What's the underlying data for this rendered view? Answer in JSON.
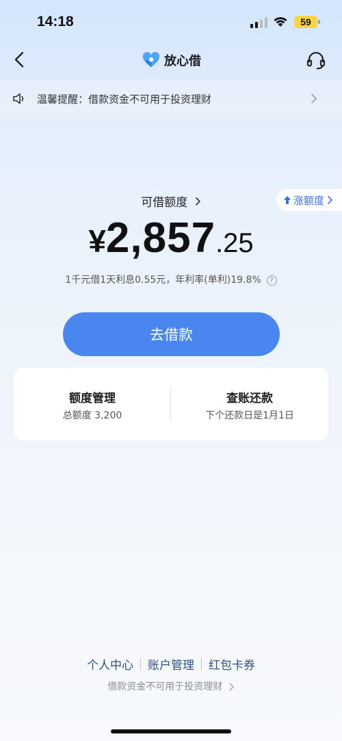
{
  "status_bar": {
    "time": "14:18",
    "battery": "59"
  },
  "nav": {
    "title": "放心借"
  },
  "notice": {
    "text": "温馨提醒：借款资金不可用于投资理财"
  },
  "raise": {
    "label": "涨额度"
  },
  "limit": {
    "title": "可借额度",
    "currency": "¥",
    "amount_int": "2,857",
    "amount_dec": ".25",
    "rate_text": "1千元借1天利息0.55元，年利率(单利)19.8%"
  },
  "borrow_button": {
    "label": "去借款"
  },
  "cards": {
    "quota": {
      "title": "额度管理",
      "sub": "总额度 3,200"
    },
    "bill": {
      "title": "查账还款",
      "sub": "下个还款日是1月1日"
    }
  },
  "footer": {
    "links": [
      "个人中心",
      "账户管理",
      "红包卡券"
    ],
    "note": "借款资金不可用于投资理财"
  },
  "colors": {
    "accent": "#4a86f0",
    "link": "#3e6fe0",
    "battery": "#f7d348"
  }
}
